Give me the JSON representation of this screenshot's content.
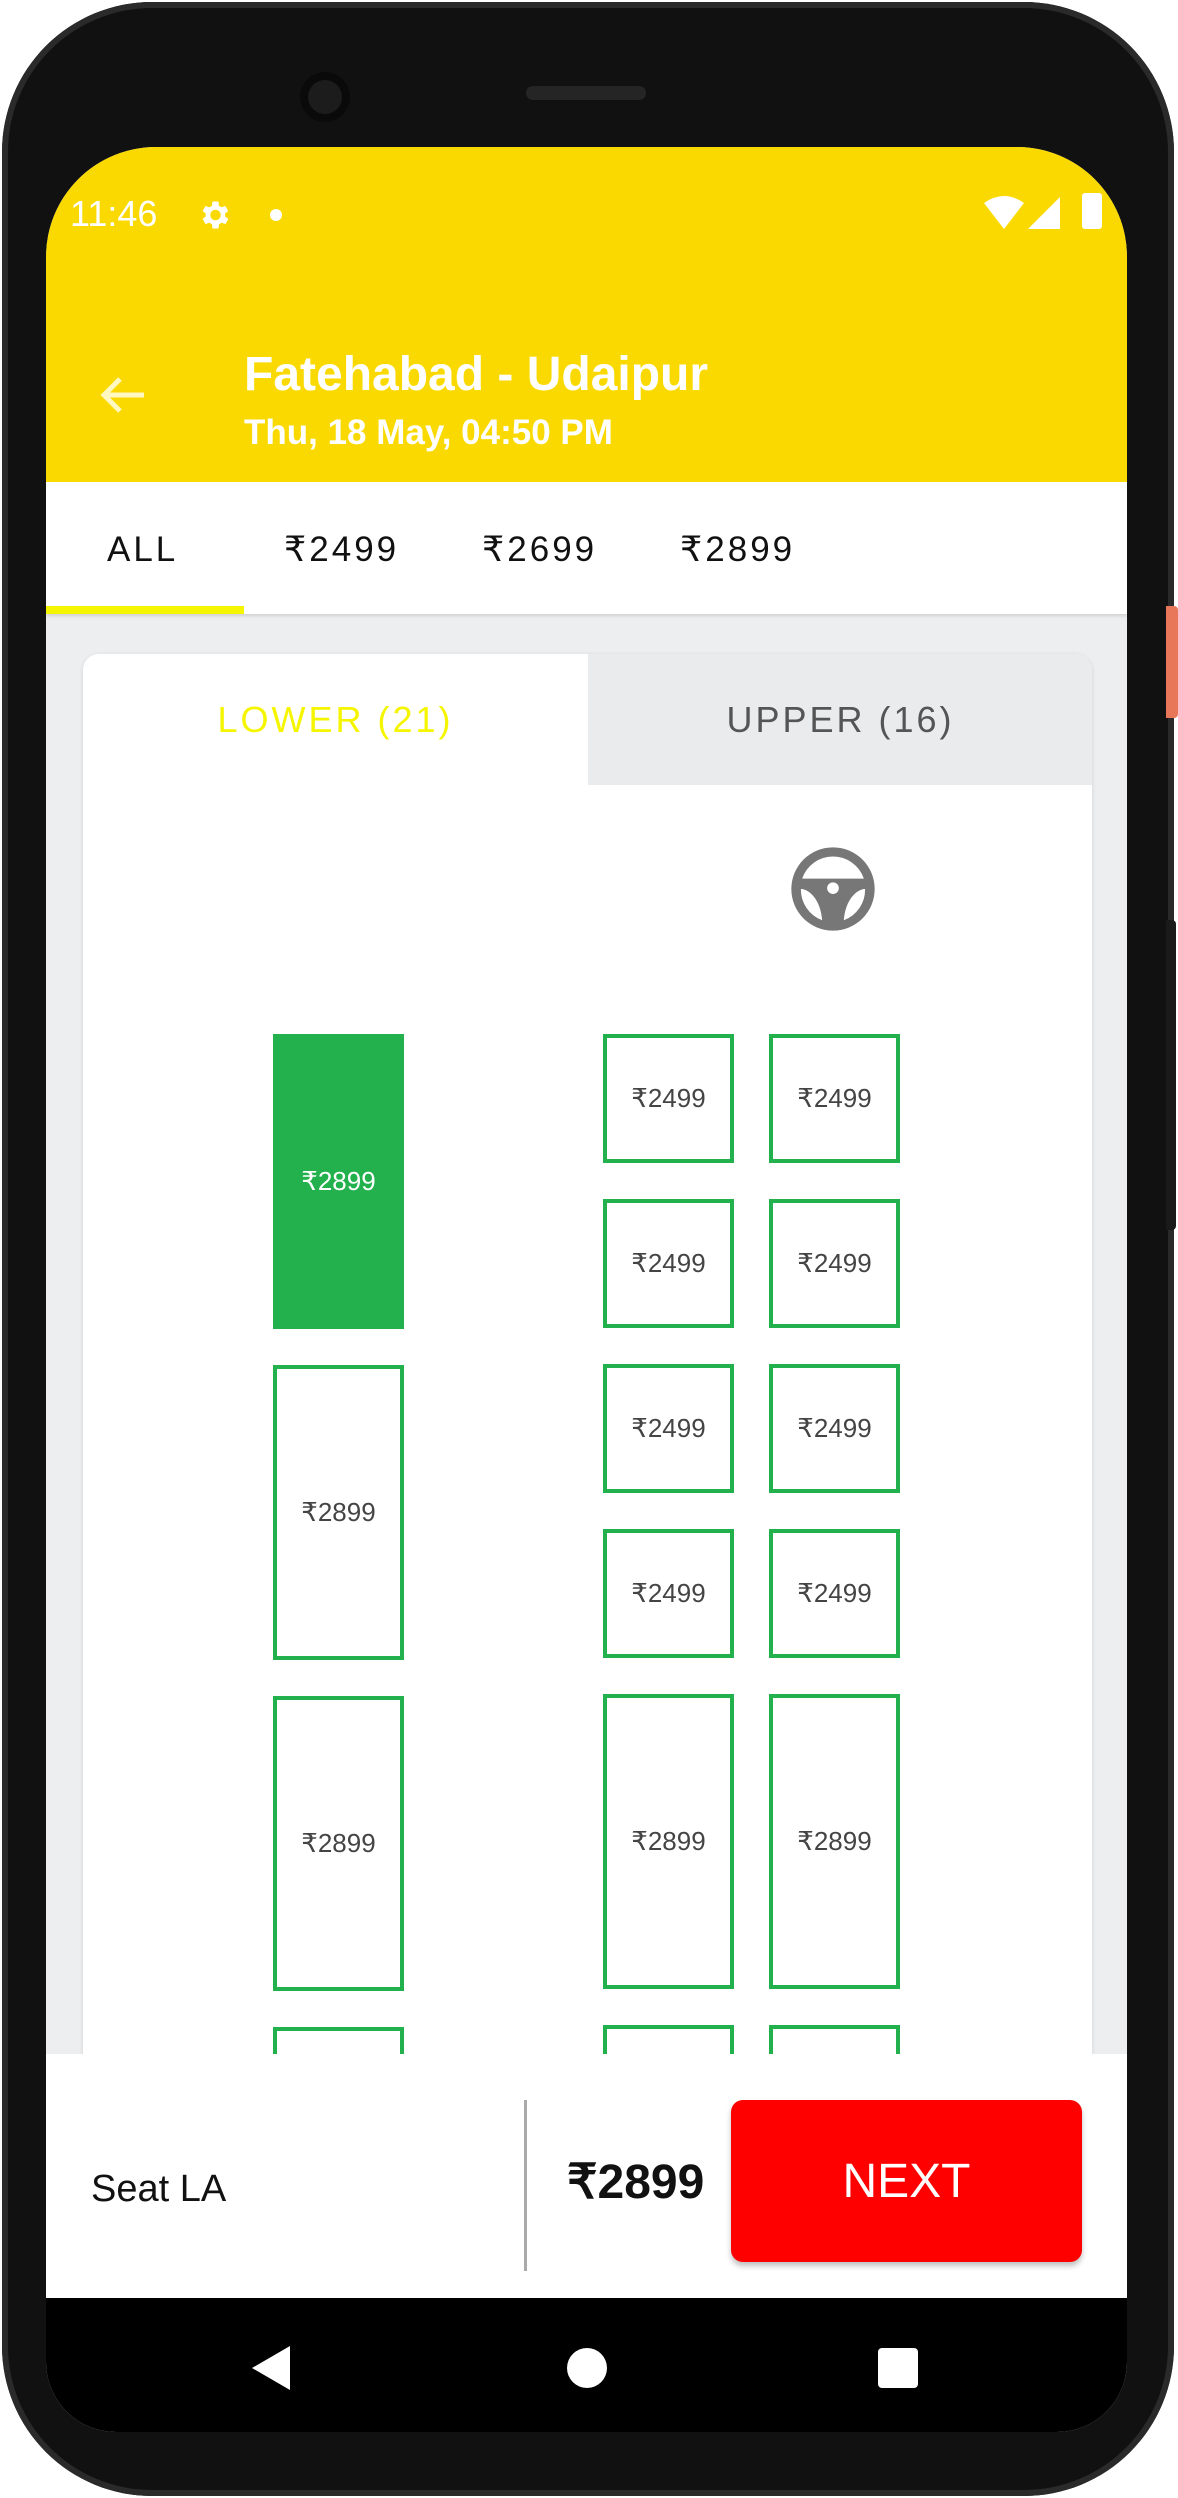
{
  "status_bar": {
    "time": "11:46",
    "icons": [
      "gear-icon",
      "notification-dot-icon",
      "wifi-icon",
      "signal-icon",
      "battery-icon"
    ]
  },
  "header": {
    "title": "Fatehabad - Udaipur",
    "subtitle": "Thu, 18 May,  04:50 PM",
    "back_icon": "arrow-left-icon"
  },
  "price_tabs": [
    {
      "label": "ALL",
      "active": true
    },
    {
      "label": "₹2499",
      "active": false
    },
    {
      "label": "₹2699",
      "active": false
    },
    {
      "label": "₹2899",
      "active": false
    }
  ],
  "deck_tabs": {
    "lower": "LOWER (21)",
    "upper": "UPPER (16)",
    "active": "lower"
  },
  "seat_map": {
    "driver_icon": "steering-wheel-icon",
    "left_column": [
      {
        "price": "₹2899",
        "type": "sleeper",
        "selected": true
      },
      {
        "price": "₹2899",
        "type": "sleeper",
        "selected": false
      },
      {
        "price": "₹2899",
        "type": "sleeper",
        "selected": false
      },
      {
        "price": "",
        "type": "sleeper",
        "selected": false
      }
    ],
    "right_columns": [
      [
        {
          "price": "₹2499",
          "type": "seater",
          "selected": false
        },
        {
          "price": "₹2499",
          "type": "seater",
          "selected": false
        },
        {
          "price": "₹2499",
          "type": "seater",
          "selected": false
        },
        {
          "price": "₹2499",
          "type": "seater",
          "selected": false
        },
        {
          "price": "₹2899",
          "type": "sleeper",
          "selected": false
        },
        {
          "price": "",
          "type": "sleeper",
          "selected": false
        }
      ],
      [
        {
          "price": "₹2499",
          "type": "seater",
          "selected": false
        },
        {
          "price": "₹2499",
          "type": "seater",
          "selected": false
        },
        {
          "price": "₹2499",
          "type": "seater",
          "selected": false
        },
        {
          "price": "₹2499",
          "type": "seater",
          "selected": false
        },
        {
          "price": "₹2899",
          "type": "sleeper",
          "selected": false
        },
        {
          "price": "",
          "type": "sleeper",
          "selected": false
        }
      ]
    ],
    "colors": {
      "available_border": "#22b14c",
      "selected_fill": "#22b14c"
    }
  },
  "footer": {
    "seat_label": "Seat LA",
    "total": "₹2899",
    "next_label": "NEXT"
  },
  "colors": {
    "header": "#f9d900",
    "accent": "#f5f500",
    "next_button": "#ff0000"
  }
}
